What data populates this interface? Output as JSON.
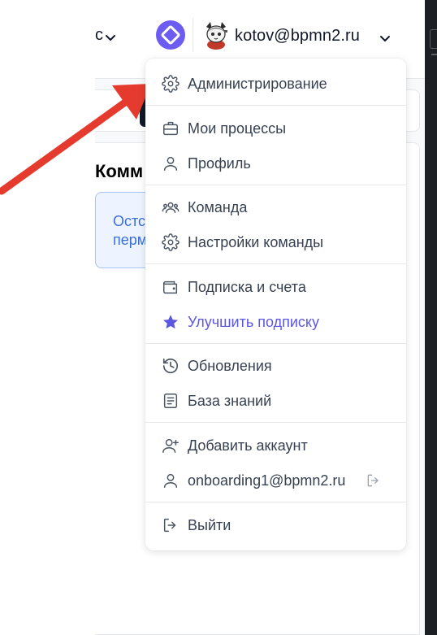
{
  "header": {
    "left_text_fragment": "с",
    "user_email": "kotov@bpmn2.ru"
  },
  "background": {
    "heading_fragment": "Комм",
    "info_lines": [
      "Остс",
      "перм"
    ]
  },
  "menu": {
    "groups": [
      [
        {
          "label": "Администрирование",
          "icon": "gear-icon"
        }
      ],
      [
        {
          "label": "Мои процессы",
          "icon": "briefcase-icon"
        },
        {
          "label": "Профиль",
          "icon": "user-icon"
        }
      ],
      [
        {
          "label": "Команда",
          "icon": "team-icon"
        },
        {
          "label": "Настройки команды",
          "icon": "gear-icon"
        }
      ],
      [
        {
          "label": "Подписка и счета",
          "icon": "wallet-icon"
        },
        {
          "label": "Улучшить подписку",
          "icon": "star-icon"
        }
      ],
      [
        {
          "label": "Обновления",
          "icon": "history-icon"
        },
        {
          "label": "База знаний",
          "icon": "book-icon"
        }
      ],
      [
        {
          "label": "Добавить аккаунт",
          "icon": "user-plus-icon"
        },
        {
          "label": "onboarding1@bpmn2.ru",
          "icon": "user-icon"
        }
      ],
      [
        {
          "label": "Выйти",
          "icon": "logout-icon"
        }
      ]
    ]
  },
  "colors": {
    "accent": "#5b57e0",
    "logo_bg": "#6d5cf2",
    "arrow": "#e53b2f",
    "info_border": "#a8c3f5"
  }
}
